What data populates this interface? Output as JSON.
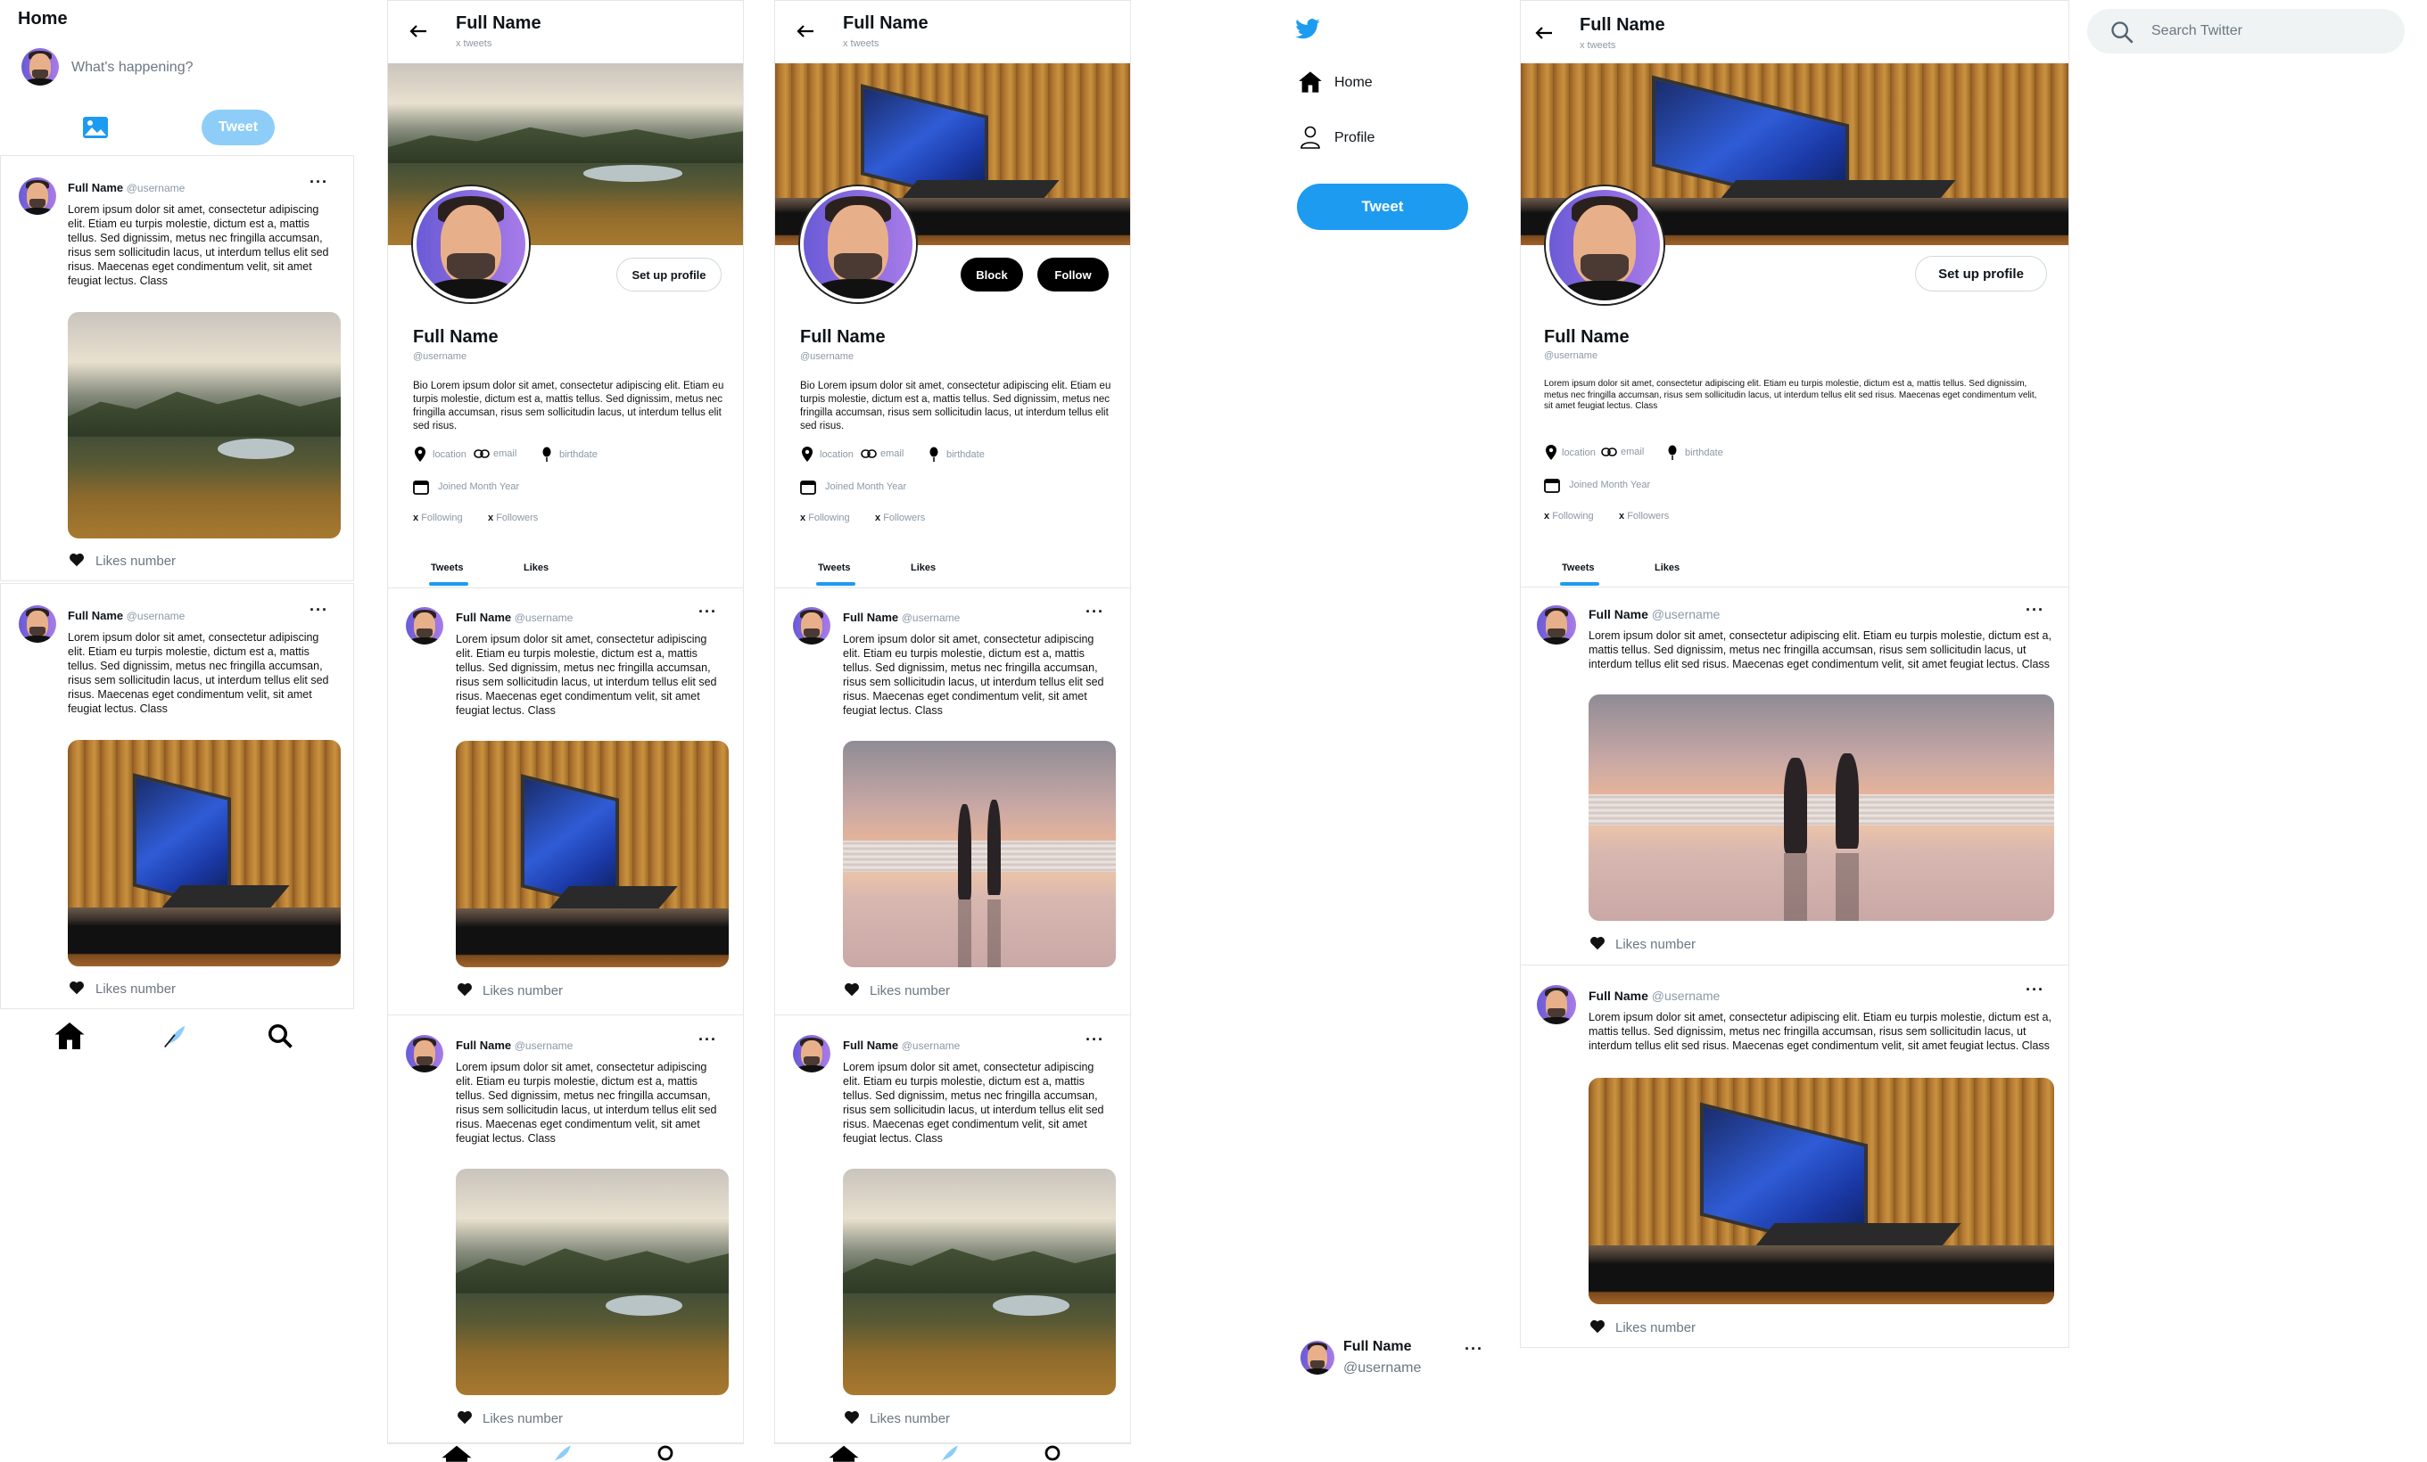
{
  "colors": {
    "accent": "#1d9bf0",
    "accent_light": "#8ecdf8",
    "text": "#0f1419",
    "muted": "#8b98a5"
  },
  "user": {
    "full_name": "Full Name",
    "username": "@username"
  },
  "home": {
    "title": "Home",
    "compose_placeholder": "What's happening?",
    "tweet_button": "Tweet"
  },
  "profile_header": {
    "title": "Full Name",
    "tweet_count": "x tweets"
  },
  "profile": {
    "name": "Full Name",
    "handle": "@username",
    "bio": "Bio Lorem ipsum dolor sit amet, consectetur adipiscing elit. Etiam eu turpis molestie, dictum est a, mattis tellus. Sed dignissim, metus nec fringilla accumsan, risus sem sollicitudin lacus, ut interdum tellus elit sed risus.",
    "bio_desktop": "Lorem ipsum dolor sit amet, consectetur adipiscing elit. Etiam eu turpis molestie, dictum est a, mattis tellus. Sed dignissim, metus nec fringilla accumsan, risus sem sollicitudin lacus, ut interdum tellus elit sed risus. Maecenas eget condimentum velit, sit amet feugiat lectus. Class",
    "location": "location",
    "email": "email",
    "birthdate": "birthdate",
    "joined": "Joined Month Year",
    "following_count": "x",
    "following_label": "Following",
    "followers_count": "x",
    "followers_label": "Followers",
    "setup_button": "Set up profile",
    "block_button": "Block",
    "follow_button": "Follow"
  },
  "tabs": {
    "tweets": "Tweets",
    "likes": "Likes"
  },
  "tweet": {
    "text": "Lorem ipsum dolor sit amet, consectetur adipiscing elit. Etiam eu turpis molestie, dictum est a, mattis tellus. Sed dignissim, metus nec fringilla accumsan, risus sem sollicitudin lacus, ut interdum tellus elit sed risus. Maecenas eget condimentum velit, sit amet feugiat lectus. Class",
    "likes": "Likes number"
  },
  "sidebar": {
    "home": "Home",
    "profile": "Profile",
    "tweet_button": "Tweet"
  },
  "search": {
    "placeholder": "Search Twitter"
  }
}
